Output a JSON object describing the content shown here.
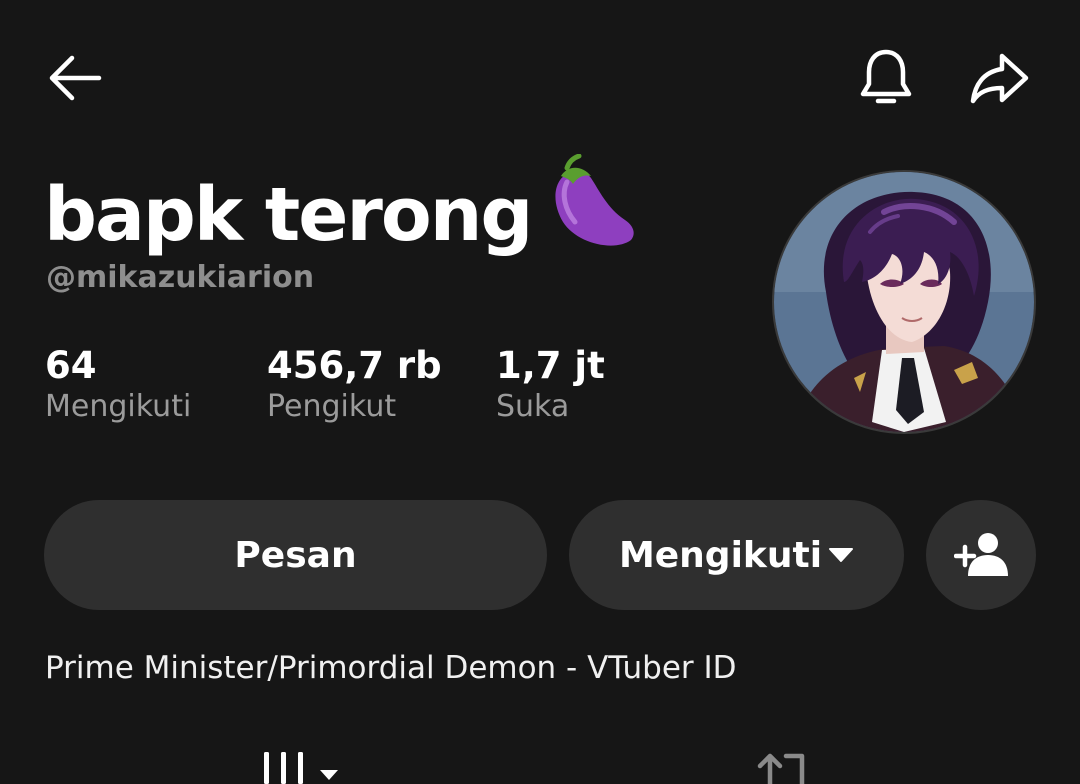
{
  "header": {
    "back_icon": "arrow-left-icon",
    "bell_icon": "bell-icon",
    "share_icon": "share-arrow-icon"
  },
  "profile": {
    "display_name": "bapk terong",
    "name_emoji": "eggplant-emoji",
    "username": "@mikazukiarion",
    "avatar": "anime-character-avatar",
    "bio": "Prime Minister/Primordial Demon - VTuber ID"
  },
  "stats": [
    {
      "value": "64",
      "label": "Mengikuti"
    },
    {
      "value": "456,7 rb",
      "label": "Pengikut"
    },
    {
      "value": "1,7 jt",
      "label": "Suka"
    }
  ],
  "actions": {
    "message_label": "Pesan",
    "following_label": "Mengikuti",
    "following_icon": "caret-down-icon",
    "add_friend_icon": "add-user-icon"
  },
  "tabs": {
    "videos_icon": "grid-bars-icon",
    "reposts_icon": "repost-icon"
  },
  "colors": {
    "background": "#161616",
    "button": "#2f2f2f",
    "secondary_text": "#8e8e8e",
    "eggplant": "#8e3fbf"
  }
}
